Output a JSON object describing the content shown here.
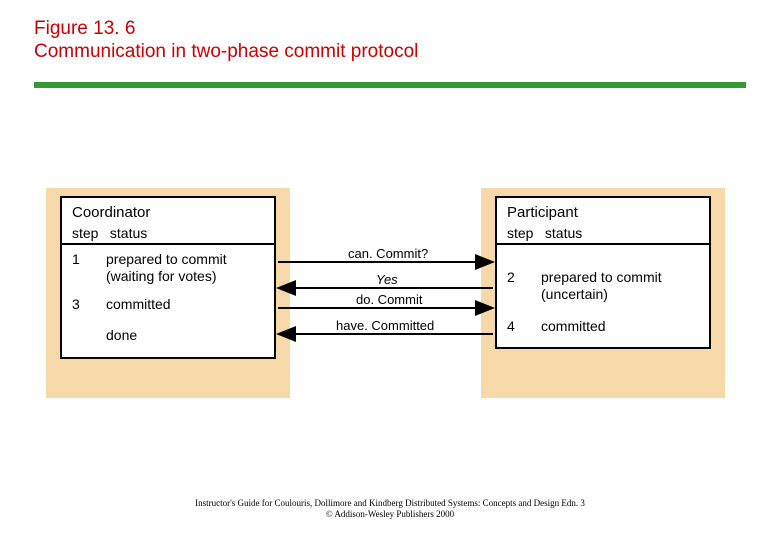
{
  "figure": {
    "number": "Figure 13. 6",
    "title": "Communication in two-phase commit protocol"
  },
  "coordinator": {
    "label": "Coordinator",
    "headers": {
      "step": "step",
      "status": "status"
    },
    "rows": [
      {
        "step": "1",
        "status_l1": "prepared to commit",
        "status_l2": "(waiting for votes)"
      },
      {
        "step": "3",
        "status_l1": "committed",
        "status_l2": ""
      }
    ],
    "footer": "done"
  },
  "participant": {
    "label": "Participant",
    "headers": {
      "step": "step",
      "status": "status"
    },
    "rows": [
      {
        "step": "2",
        "status_l1": "prepared to commit",
        "status_l2": "(uncertain)"
      },
      {
        "step": "4",
        "status_l1": "committed",
        "status_l2": ""
      }
    ]
  },
  "messages": {
    "m1": "can. Commit?",
    "m2": "Yes",
    "m3": "do. Commit",
    "m4": "have. Committed"
  },
  "footer": {
    "line1": "Instructor's Guide for Coulouris, Dollimore and Kindberg  Distributed Systems: Concepts and Design  Edn. 3",
    "line2": "©  Addison-Wesley Publishers 2000"
  }
}
